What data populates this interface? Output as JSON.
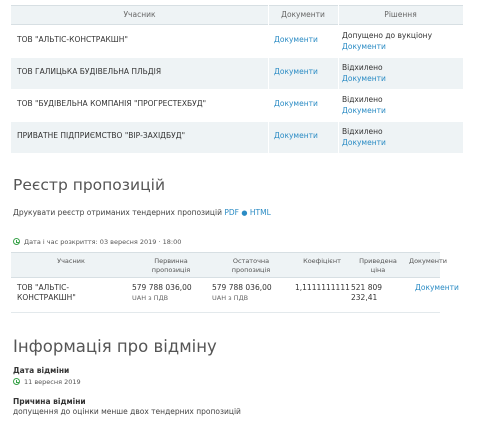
{
  "participants": {
    "headers": [
      "Учасник",
      "Документи",
      "Рішення"
    ],
    "rows": [
      {
        "name": "ТОВ \"АЛЬТІС-КОНСТРАКШН\"",
        "docs": "Документи",
        "decision": "Допущено до вукціону",
        "decision_docs": "Документи"
      },
      {
        "name": "ТОВ ГАЛИЦЬКА БУДІВЕЛЬНА ПЛЬДІЯ",
        "docs": "Документи",
        "decision": "Відхилено",
        "decision_docs": "Документи"
      },
      {
        "name": "ТОВ \"БУДІВЕЛЬНА КОМПАНІЯ \"ПРОГРЕСТЕХБУД\"",
        "docs": "Документи",
        "decision": "Відхилено",
        "decision_docs": "Документи"
      },
      {
        "name": "ПРИВАТНЕ ПІДПРИЄМСТВО \"ВІР-ЗАХІДБУД\"",
        "docs": "Документи",
        "decision": "Відхилено",
        "decision_docs": "Документи"
      }
    ]
  },
  "registry": {
    "title": "Реєстр пропозицій",
    "print_text": "Друкувати реєстр отриманих тендерних пропозицій",
    "pdf": "PDF",
    "separator": "●",
    "html": "HTML",
    "open_date": "Дата і час розкриття: 03 вересня 2019  ·  18:00"
  },
  "proposals": {
    "headers": {
      "participant": "Учасник",
      "initial_1": "Первинна",
      "initial_2": "пропозиція",
      "final_1": "Остаточна",
      "final_2": "пропозиція",
      "coef": "Коефіцієнт",
      "reduced_1": "Приведена",
      "reduced_2": "ціна",
      "docs": "Документи"
    },
    "rows": [
      {
        "name_1": "ТОВ \"АЛЬТІС-",
        "name_2": "КОНСТРАКШН\"",
        "initial": "579 788 036,00",
        "initial_sub": "UAH з ПДВ",
        "final": "579 788 036,00",
        "final_sub": "UAH з ПДВ",
        "coef": "1,1111111111",
        "reduced_1": "521 809",
        "reduced_2": "232,41",
        "docs": "Документи"
      }
    ]
  },
  "cancellation": {
    "title": "Інформація про відміну",
    "date_label": "Дата відміни",
    "date": "11 вересня 2019",
    "reason_label": "Причина відміни",
    "reason": "допущення до оцінки менше двох тендерних пропозицій"
  },
  "colors": {
    "link": "#2a8bc4",
    "header_bg": "#eef3f5",
    "clock": "#3aa34a"
  }
}
